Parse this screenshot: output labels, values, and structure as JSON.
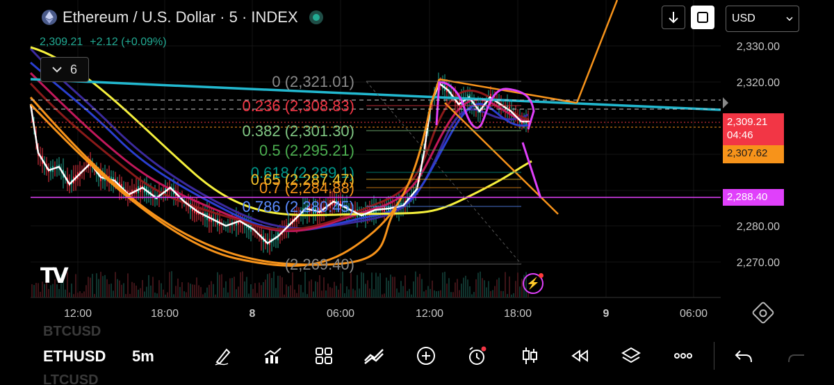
{
  "header": {
    "title": "Ethereum / U.S. Dollar · 5 · INDEX",
    "last_price": "2,309.21",
    "change": "+2.12 (+0.09%)",
    "indicator_count": "6"
  },
  "toolbar_top": {
    "currency": "USD"
  },
  "price_axis": {
    "labels": [
      "2,330.00",
      "2,320.00",
      "2,280.00",
      "2,270.00"
    ]
  },
  "price_tags": {
    "last": "2,309.21",
    "countdown": "04:46",
    "orange": "2,307.62",
    "magenta": "2,288.40"
  },
  "time_axis": {
    "labels": [
      "12:00",
      "18:00",
      "8",
      "06:00",
      "12:00",
      "18:00",
      "9",
      "06:00"
    ]
  },
  "fib_levels": [
    {
      "label": "0 (2,321.01)",
      "color": "#8a8a8a"
    },
    {
      "label": "0.236 (2,308.83)",
      "color": "#f23645"
    },
    {
      "label": "0.382 (2,301.30)",
      "color": "#81c784"
    },
    {
      "label": "0.5 (2,295.21)",
      "color": "#4caf50"
    },
    {
      "label": "0.618 (2,289.1)",
      "color": "#009688"
    },
    {
      "label": "0.65 (2,287.47)",
      "color": "#f7c32b"
    },
    {
      "label": "0.7 (2,284.88)",
      "color": "#f7931a"
    },
    {
      "label": "0.786 (2,280.45)",
      "color": "#5b8cff"
    },
    {
      "label": "(2,269.40)",
      "color": "#8a8a8a"
    }
  ],
  "bottom": {
    "symbols": [
      "BTCUSD",
      "ETHUSD",
      "LTCUSD"
    ],
    "active_timeframe": "5m",
    "tools": [
      "drawing-tools-icon",
      "indicators-icon",
      "templates-icon",
      "compare-icon",
      "add-icon",
      "alert-icon",
      "chart-type-icon",
      "replay-icon",
      "layers-icon",
      "more-icon",
      "undo-icon"
    ]
  },
  "colors": {
    "up": "#22ab94",
    "down": "#f23645",
    "orange": "#f7931a",
    "magenta": "#e040fb",
    "cyan": "#22b8cf",
    "yellow": "#f5f03c"
  }
}
